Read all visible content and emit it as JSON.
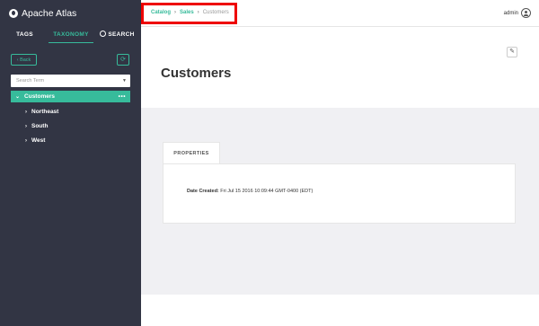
{
  "app": {
    "title": "Apache Atlas"
  },
  "sidebar": {
    "tabs": [
      {
        "label": "TAGS"
      },
      {
        "label": "TAXONOMY"
      },
      {
        "label": "SEARCH"
      }
    ],
    "back_label": "Back",
    "search_term": {
      "placeholder": "Search Term"
    },
    "tree": [
      {
        "label": "Customers",
        "more": "•••"
      },
      {
        "label": "Northeast"
      },
      {
        "label": "South"
      },
      {
        "label": "West"
      }
    ]
  },
  "header": {
    "breadcrumb": [
      {
        "label": "Catalog"
      },
      {
        "label": "Sales"
      },
      {
        "label": "Customers"
      }
    ],
    "user": "admin"
  },
  "main": {
    "title": "Customers",
    "panel_tab": "PROPERTIES",
    "properties": [
      {
        "key": "Date Created:",
        "value": "Fri Jul 15 2016 10:09:44 GMT-0400 (EDT)"
      }
    ]
  },
  "colors": {
    "accent": "#37bb9b",
    "sidebar_bg": "#323544",
    "highlight": "#e00000"
  }
}
